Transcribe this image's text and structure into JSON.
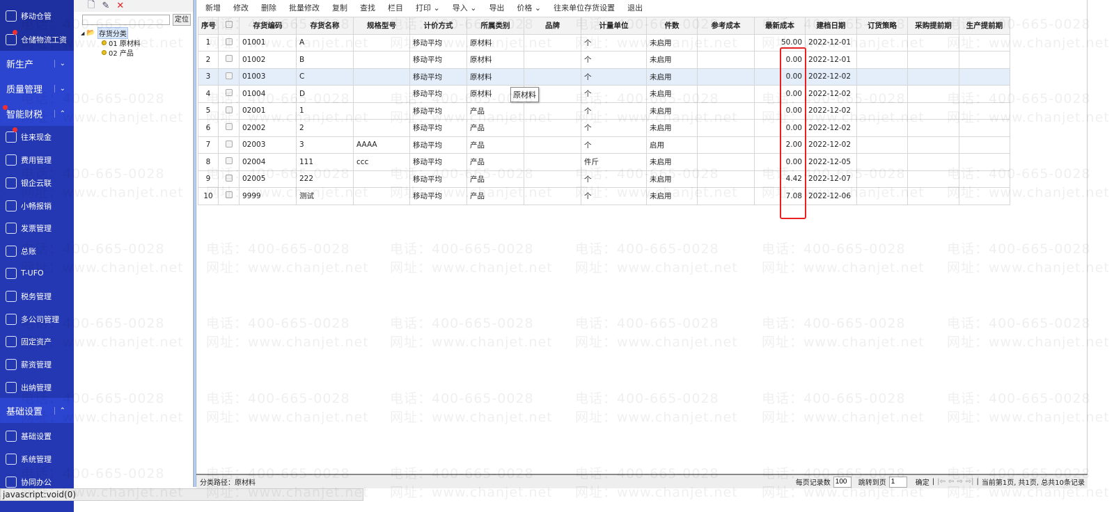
{
  "sidebar": {
    "items": [
      {
        "label": "移动仓管",
        "top": 0,
        "dot": false
      },
      {
        "label": "仓储物流工资",
        "dot": true
      }
    ],
    "sections": [
      {
        "label": "新生产",
        "chevron": "down"
      },
      {
        "label": "质量管理",
        "chevron": "down"
      },
      {
        "label": "智能财税",
        "chevron": "up",
        "dot": true
      }
    ],
    "sub_items": [
      {
        "label": "往来现金",
        "dot": true
      },
      {
        "label": "费用管理"
      },
      {
        "label": "银企云联"
      },
      {
        "label": "小畅报销"
      },
      {
        "label": "发票管理"
      },
      {
        "label": "总账"
      },
      {
        "label": "T-UFO"
      },
      {
        "label": "税务管理"
      },
      {
        "label": "多公司管理"
      },
      {
        "label": "固定资产"
      },
      {
        "label": "薪资管理"
      },
      {
        "label": "出纳管理"
      }
    ],
    "section_basic": {
      "label": "基础设置",
      "chevron": "up"
    },
    "basic_items": [
      {
        "label": "基础设置"
      },
      {
        "label": "系统管理"
      },
      {
        "label": "协同办公"
      }
    ]
  },
  "tree": {
    "locate_label": "定位",
    "search_value": "",
    "root": "存货分类",
    "children": [
      "01 原材料",
      "02 产品"
    ]
  },
  "toolbar": [
    "新增",
    "修改",
    "删除",
    "批量修改",
    "复制",
    "查找",
    "栏目",
    "打印 ⌄",
    "导入 ⌄",
    "导出",
    "价格 ⌄",
    "往来单位存货设置",
    "退出"
  ],
  "table": {
    "columns": [
      "序号",
      "",
      "存货编码",
      "存货名称",
      "规格型号",
      "计价方式",
      "所属类别",
      "品牌",
      "计量单位",
      "件数",
      "参考成本",
      "最新成本",
      "建档日期",
      "订货策略",
      "采购提前期",
      "生产提前期"
    ],
    "rows": [
      [
        "1",
        "01001",
        "A",
        "",
        "移动平均",
        "原材料",
        "",
        "个",
        "未启用",
        "",
        "50.00",
        "2022-12-01",
        "",
        "",
        ""
      ],
      [
        "2",
        "01002",
        "B",
        "",
        "移动平均",
        "原材料",
        "",
        "个",
        "未启用",
        "",
        "0.00",
        "2022-12-01",
        "",
        "",
        ""
      ],
      [
        "3",
        "01003",
        "C",
        "",
        "移动平均",
        "原材料",
        "",
        "个",
        "未启用",
        "",
        "0.00",
        "2022-12-02",
        "",
        "",
        ""
      ],
      [
        "4",
        "01004",
        "D",
        "",
        "移动平均",
        "原材料",
        "",
        "个",
        "未启用",
        "",
        "0.00",
        "2022-12-02",
        "",
        "",
        ""
      ],
      [
        "5",
        "02001",
        "1",
        "",
        "移动平均",
        "产品",
        "",
        "个",
        "未启用",
        "",
        "0.00",
        "2022-12-02",
        "",
        "",
        ""
      ],
      [
        "6",
        "02002",
        "2",
        "",
        "移动平均",
        "产品",
        "",
        "个",
        "未启用",
        "",
        "0.00",
        "2022-12-02",
        "",
        "",
        ""
      ],
      [
        "7",
        "02003",
        "3",
        "AAAA",
        "移动平均",
        "产品",
        "",
        "个",
        "启用",
        "",
        "2.00",
        "2022-12-02",
        "",
        "",
        ""
      ],
      [
        "8",
        "02004",
        "111",
        "ccc",
        "移动平均",
        "产品",
        "",
        "件斤",
        "未启用",
        "",
        "0.00",
        "2022-12-05",
        "",
        "",
        ""
      ],
      [
        "9",
        "02005",
        "222",
        "",
        "移动平均",
        "产品",
        "",
        "个",
        "未启用",
        "",
        "4.42",
        "2022-12-07",
        "",
        "",
        ""
      ],
      [
        "10",
        "9999",
        "测试",
        "",
        "移动平均",
        "产品",
        "",
        "个",
        "未启用",
        "",
        "7.08",
        "2022-12-06",
        "",
        "",
        ""
      ]
    ],
    "selected_row": 3,
    "tooltip": "原材料"
  },
  "footer": {
    "path_label": "分类路径：",
    "path_value": "原材料",
    "per_page_label": "每页记录数",
    "per_page": "100",
    "goto_label": "跳转到页",
    "goto": "1",
    "confirm": "确定",
    "sep": "|",
    "nav": [
      "|⇦",
      "⇦",
      "⇨",
      "⇨|"
    ],
    "summary": "当前第1页, 共1页, 总共10条记录"
  },
  "status_bar": "javascript:void(0)",
  "watermark": {
    "phone": "电话：400-665-0028",
    "url": "网址：www.chanjet.net"
  },
  "colors": {
    "sidebar": "#2438b4",
    "highlight": "#e82020",
    "selected_row": "#e4eefb"
  }
}
